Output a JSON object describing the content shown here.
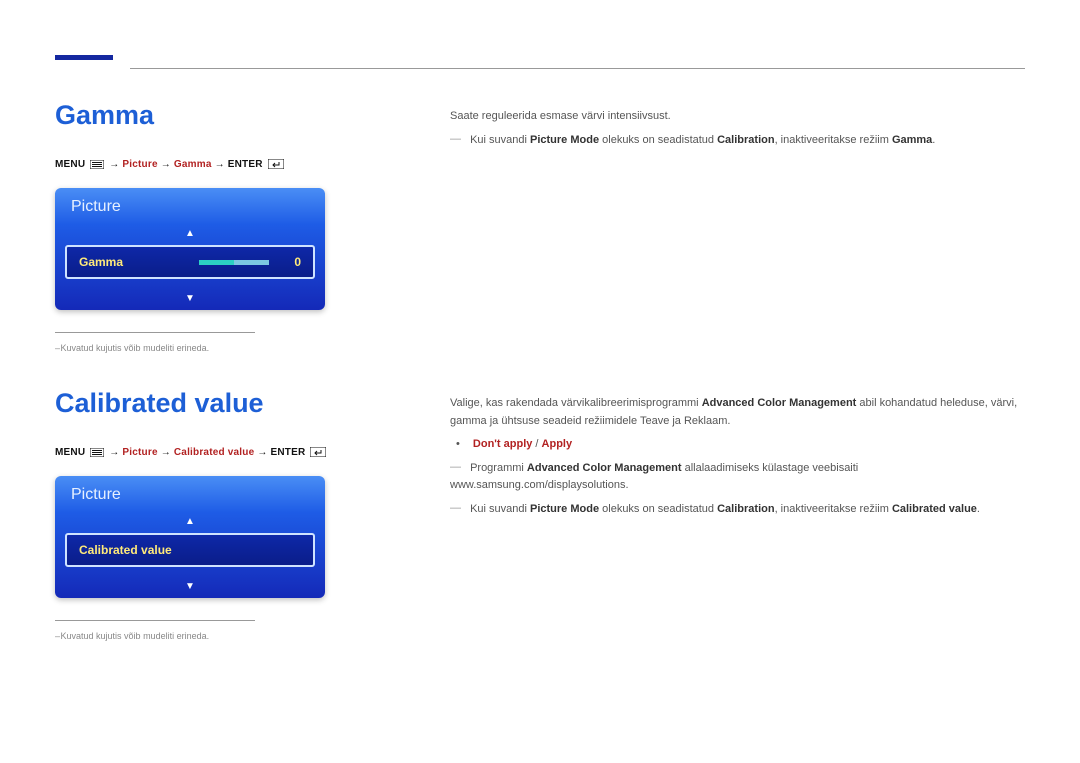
{
  "header_marker": true,
  "section1": {
    "title": "Gamma",
    "nav": {
      "prefix": "MENU ",
      "arrow": "→",
      "path1": "Picture",
      "path2": "Gamma",
      "enter": "ENTER"
    },
    "osd": {
      "panel_title": "Picture",
      "row_label": "Gamma",
      "row_value": "0"
    },
    "footnote": "Kuvatud kujutis võib mudeliti erineda.",
    "body": {
      "line1": "Saate reguleerida esmase värvi intensiivsust.",
      "note_prefix": "Kui suvandi ",
      "note_b1": "Picture Mode",
      "note_mid": " olekuks on seadistatud ",
      "note_b2": "Calibration",
      "note_mid2": ", inaktiveeritakse režiim ",
      "note_b3": "Gamma",
      "note_end": "."
    }
  },
  "section2": {
    "title": "Calibrated value",
    "nav": {
      "prefix": "MENU ",
      "arrow": "→",
      "path1": "Picture",
      "path2": "Calibrated value",
      "enter": "ENTER"
    },
    "osd": {
      "panel_title": "Picture",
      "row_label": "Calibrated value"
    },
    "footnote": "Kuvatud kujutis võib mudeliti erineda.",
    "body": {
      "line1a": "Valige, kas rakendada värvikalibreerimisprogrammi ",
      "line1b": "Advanced Color Management",
      "line1c": " abil kohandatud heleduse, värvi, gamma ja ühtsuse seadeid režiimidele Teave ja Reklaam.",
      "options_a": "Don't apply",
      "options_sep": " / ",
      "options_b": "Apply",
      "note2a": "Programmi ",
      "note2b": "Advanced Color Management",
      "note2c": " allalaadimiseks külastage veebisaiti www.samsung.com/displaysolutions.",
      "note3_prefix": "Kui suvandi ",
      "note3_b1": "Picture Mode",
      "note3_mid": " olekuks on seadistatud ",
      "note3_b2": "Calibration",
      "note3_mid2": ", inaktiveeritakse režiim ",
      "note3_b3": "Calibrated value",
      "note3_end": "."
    }
  }
}
